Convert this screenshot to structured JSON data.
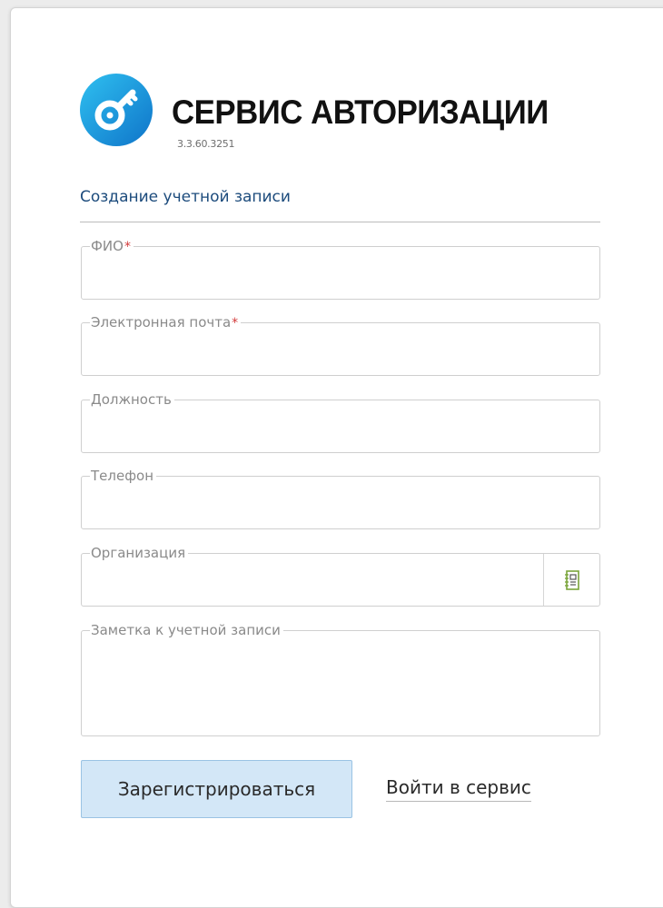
{
  "header": {
    "title": "СЕРВИС АВТОРИЗАЦИИ",
    "version": "3.3.60.3251",
    "logo_icon": "key-icon"
  },
  "form": {
    "title": "Создание учетной записи",
    "fields": [
      {
        "label": "ФИО",
        "required_mark": "*",
        "value": ""
      },
      {
        "label": "Электронная почта",
        "required_mark": "*",
        "value": ""
      },
      {
        "label": "Должность",
        "required_mark": "",
        "value": ""
      },
      {
        "label": "Телефон",
        "required_mark": "",
        "value": ""
      },
      {
        "label": "Организация",
        "required_mark": "",
        "value": "",
        "action_icon": "address-book-icon"
      },
      {
        "label": "Заметка к учетной записи",
        "required_mark": "",
        "value": ""
      }
    ]
  },
  "actions": {
    "register_label": "Зарегистрироваться",
    "login_label": "Войти в сервис"
  },
  "colors": {
    "brand_blue": "#1aa3e8",
    "title_blue": "#1c4b7c",
    "required_red": "#d33a3a",
    "primary_button_bg": "#d3e7f7",
    "icon_green": "#7aa43a"
  }
}
